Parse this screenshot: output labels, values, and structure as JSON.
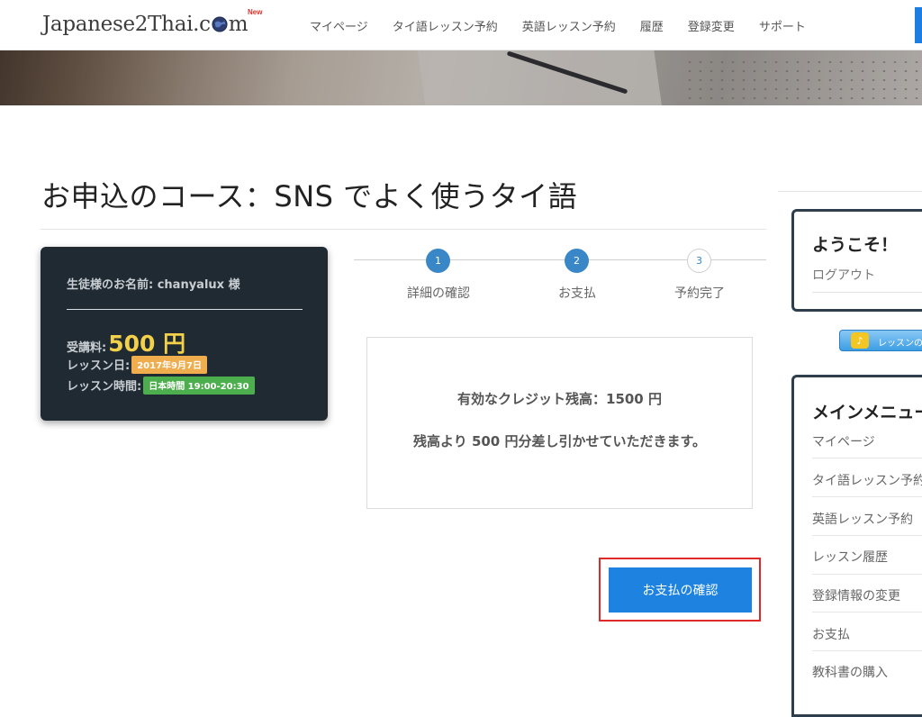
{
  "header": {
    "logo_text": "Japanese2Thai.c",
    "logo_text_end": "m",
    "logo_badge": "New",
    "nav": [
      "マイページ",
      "タイ語レッスン予約",
      "英語レッスン予約",
      "履歴",
      "登録変更",
      "サポート"
    ]
  },
  "page": {
    "title": "お申込のコース：SNS でよく使うタイ語"
  },
  "student": {
    "name_line": "生徒様のお名前: chanyalux 様",
    "fee_label": "受講料:",
    "fee_amount": "500 円",
    "date_label": "レッスン日:",
    "date_value": "2017年9月7日",
    "time_label": "レッスン時間:",
    "time_value": "日本時間 19:00-20:30"
  },
  "steps": [
    {
      "number": "1",
      "label": "詳細の確認",
      "state": "done"
    },
    {
      "number": "2",
      "label": "お支払",
      "state": "done"
    },
    {
      "number": "3",
      "label": "予約完了",
      "state": "todo"
    }
  ],
  "credit": {
    "balance_line": "有効なクレジット残高：1500 円",
    "deduct_line": "残高より 500 円分差し引かせていただきます。"
  },
  "confirm_button": "お支払の確認",
  "sidebar": {
    "welcome_title": "ようこそ！",
    "logout": "ログアウト",
    "banner_text": "レッスンの",
    "menu_title": "メインメニュー",
    "menu_items": [
      "マイページ",
      "タイ語レッスン予約",
      "英語レッスン予約",
      "レッスン履歴",
      "登録情報の変更",
      "お支払",
      "教科書の購入"
    ]
  },
  "colors": {
    "primary_button": "#1d82e0",
    "highlight_frame": "#e02a2a",
    "card_bg": "#1f2a33",
    "fee_amount": "#f3d04a",
    "badge_date": "#f0ad4e",
    "badge_time": "#4cae4c",
    "step_active": "#3a87c8"
  }
}
